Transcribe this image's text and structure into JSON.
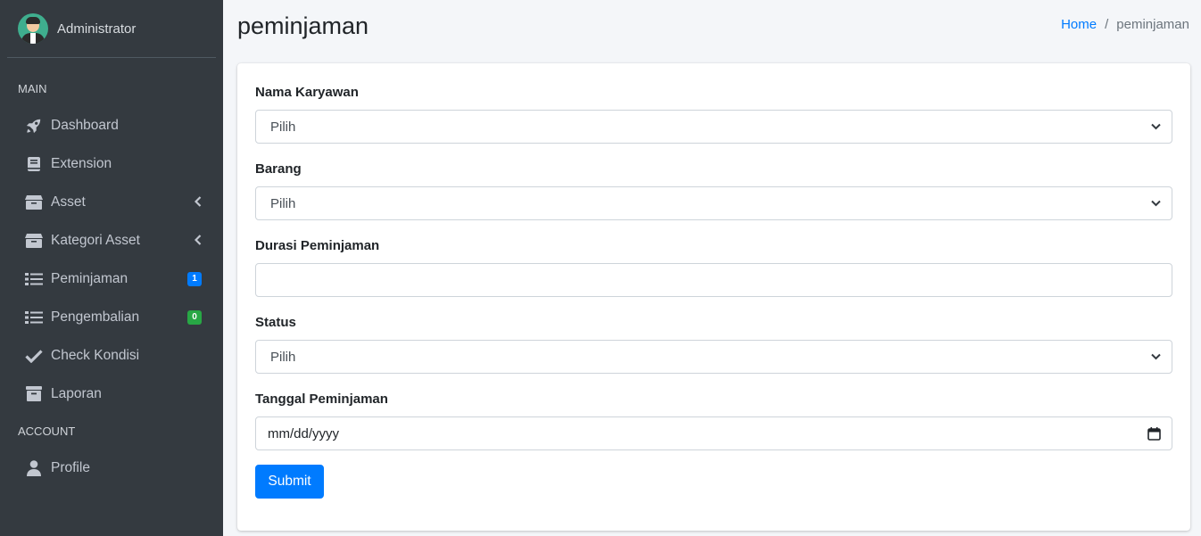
{
  "sidebar": {
    "user_name": "Administrator",
    "section_main": "MAIN",
    "section_account": "ACCOUNT",
    "items": [
      {
        "label": "Dashboard",
        "icon": "rocket-icon"
      },
      {
        "label": "Extension",
        "icon": "book-icon"
      },
      {
        "label": "Asset",
        "icon": "box-icon"
      },
      {
        "label": "Kategori Asset",
        "icon": "box-icon"
      },
      {
        "label": "Peminjaman",
        "icon": "list-icon",
        "badge": "1"
      },
      {
        "label": "Pengembalian",
        "icon": "list-icon",
        "badge": "0"
      },
      {
        "label": "Check Kondisi",
        "icon": "check-icon"
      },
      {
        "label": "Laporan",
        "icon": "archive-icon"
      }
    ],
    "account_items": [
      {
        "label": "Profile",
        "icon": "user-icon"
      }
    ]
  },
  "header": {
    "title": "peminjaman",
    "breadcrumb_home": "Home",
    "breadcrumb_separator": "/",
    "breadcrumb_current": "peminjaman"
  },
  "form": {
    "nama_karyawan_label": "Nama Karyawan",
    "nama_karyawan_value": "Pilih",
    "barang_label": "Barang",
    "barang_value": "Pilih",
    "durasi_label": "Durasi Peminjaman",
    "durasi_value": "",
    "status_label": "Status",
    "status_value": "Pilih",
    "tanggal_label": "Tanggal Peminjaman",
    "tanggal_value": "mm/dd/yyyy",
    "submit_label": "Submit"
  },
  "colors": {
    "sidebar_bg": "#343a40",
    "primary": "#007bff",
    "success": "#28a745",
    "page_bg": "#f4f6f9"
  }
}
